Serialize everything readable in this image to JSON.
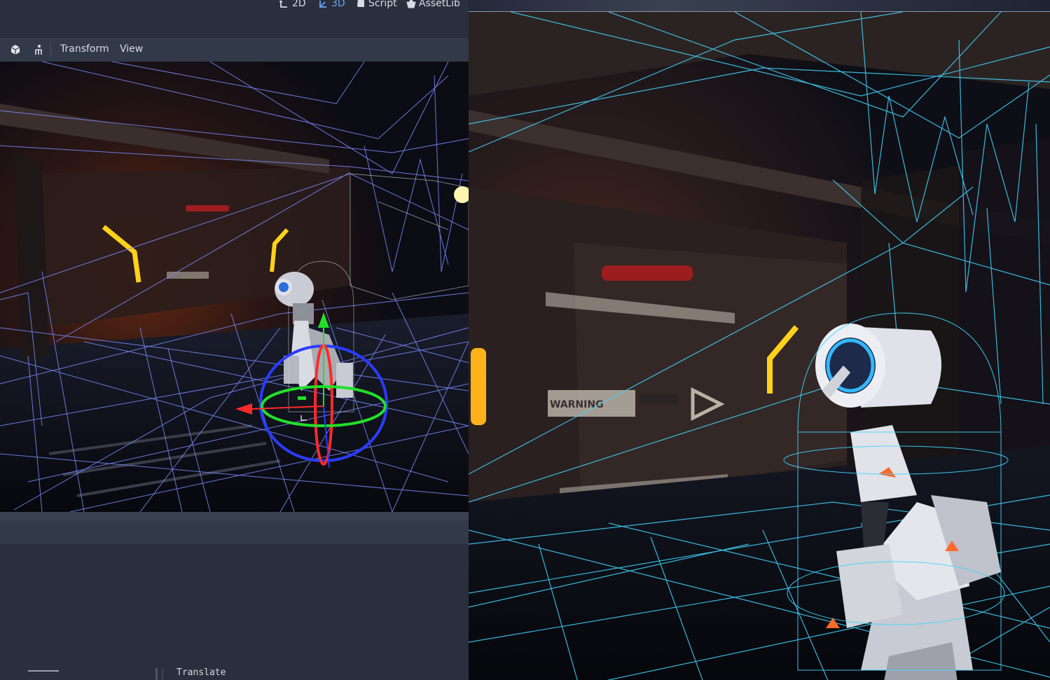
{
  "editor": {
    "modes": [
      {
        "label": "2D",
        "icon": "2d-mode-icon",
        "active": false
      },
      {
        "label": "3D",
        "icon": "3d-mode-icon",
        "active": true
      },
      {
        "label": "Script",
        "icon": "script-icon",
        "active": false
      },
      {
        "label": "AssetLib",
        "icon": "assetlib-icon",
        "active": false
      }
    ],
    "viewport_toolbar": {
      "icons": [
        "cube-icon",
        "skeleton-icon"
      ],
      "menus": [
        "Transform",
        "View"
      ]
    },
    "status": {
      "mode_label": "Translate"
    }
  },
  "colors": {
    "panel_bg": "#2a2f3d",
    "toolbar_bg": "#323949",
    "accent": "#6aa5f5",
    "gizmo_x": "#ff2a2a",
    "gizmo_y": "#22e02a",
    "gizmo_z": "#2a3cff",
    "wireframe_small": "#7c8bff",
    "wireframe_large": "#3fd6ff",
    "warning_light": "#ffd21a"
  },
  "scene": {
    "wall_sign": "WARNING"
  }
}
